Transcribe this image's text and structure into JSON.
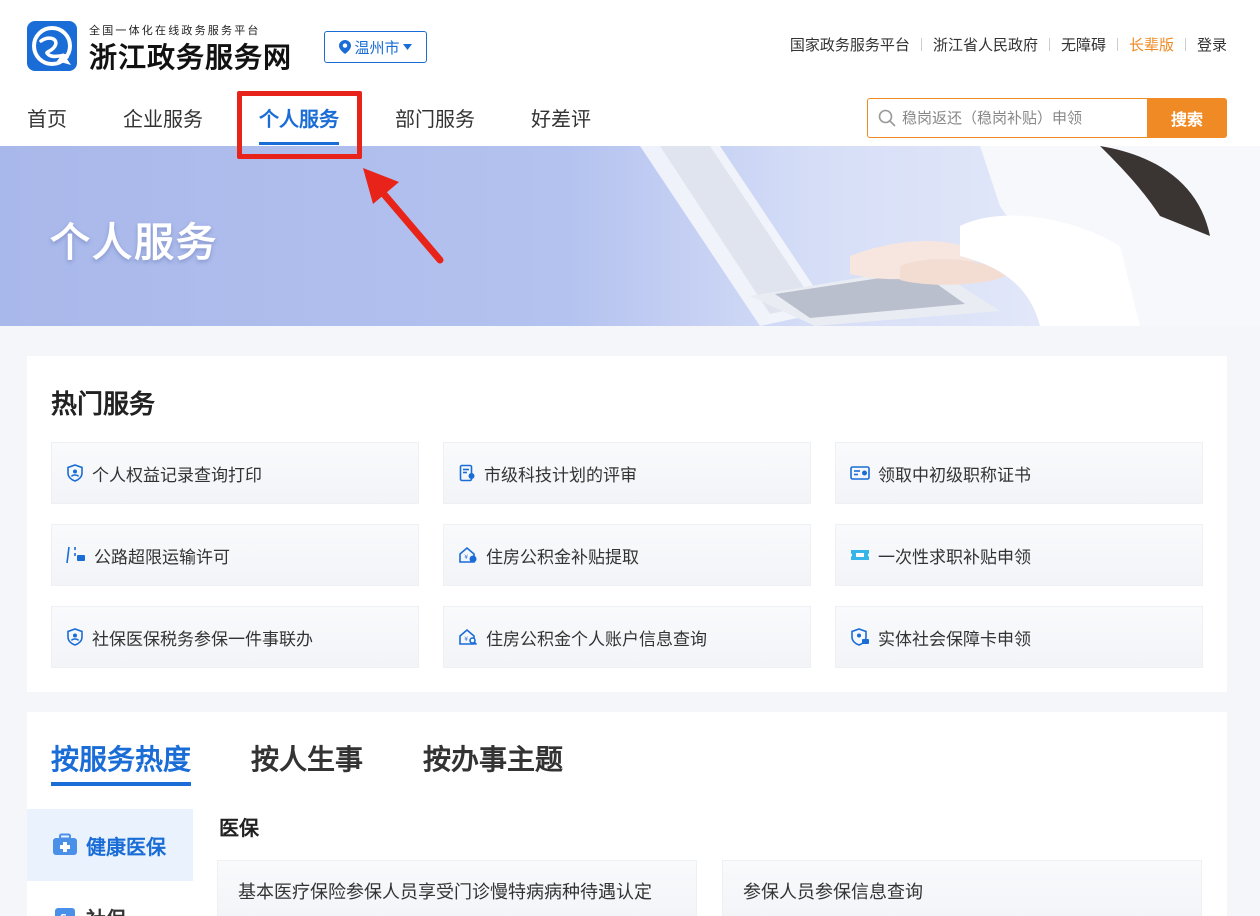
{
  "header": {
    "brand_subtitle": "全国一体化在线政务服务平台",
    "brand_title": "浙江政务服务网",
    "city": "温州市",
    "top_links": [
      "国家政务服务平台",
      "浙江省人民政府",
      "无障碍",
      "长辈版",
      "登录"
    ]
  },
  "nav": {
    "items": [
      "首页",
      "企业服务",
      "个人服务",
      "部门服务",
      "好差评"
    ],
    "active": "个人服务"
  },
  "search": {
    "placeholder": "稳岗返还（稳岗补贴）申领",
    "button": "搜索"
  },
  "banner": {
    "title": "个人服务"
  },
  "hot_services": {
    "title": "热门服务",
    "items": [
      {
        "label": "个人权益记录查询打印",
        "icon": "shield-user-icon"
      },
      {
        "label": "市级科技计划的评审",
        "icon": "document-user-icon"
      },
      {
        "label": "领取中初级职称证书",
        "icon": "certificate-icon"
      },
      {
        "label": "公路超限运输许可",
        "icon": "road-truck-icon"
      },
      {
        "label": "住房公积金补贴提取",
        "icon": "house-money-icon"
      },
      {
        "label": "一次性求职补贴申领",
        "icon": "ticket-icon"
      },
      {
        "label": "社保医保税务参保一件事联办",
        "icon": "shield-user-icon"
      },
      {
        "label": "住房公积金个人账户信息查询",
        "icon": "house-search-icon"
      },
      {
        "label": "实体社会保障卡申领",
        "icon": "shield-card-icon"
      }
    ]
  },
  "categories": {
    "tabs": [
      "按服务热度",
      "按人生事",
      "按办事主题"
    ],
    "active_tab": "按服务热度",
    "side": [
      "健康医保",
      "社保"
    ],
    "active_side": "健康医保",
    "sub_title": "医保",
    "items": [
      "基本医疗保险参保人员享受门诊慢特病病种待遇认定",
      "参保人员参保信息查询"
    ]
  },
  "colors": {
    "primary": "#1a6dd6",
    "accent_orange": "#f08a24",
    "highlight_red": "#e8231a"
  }
}
